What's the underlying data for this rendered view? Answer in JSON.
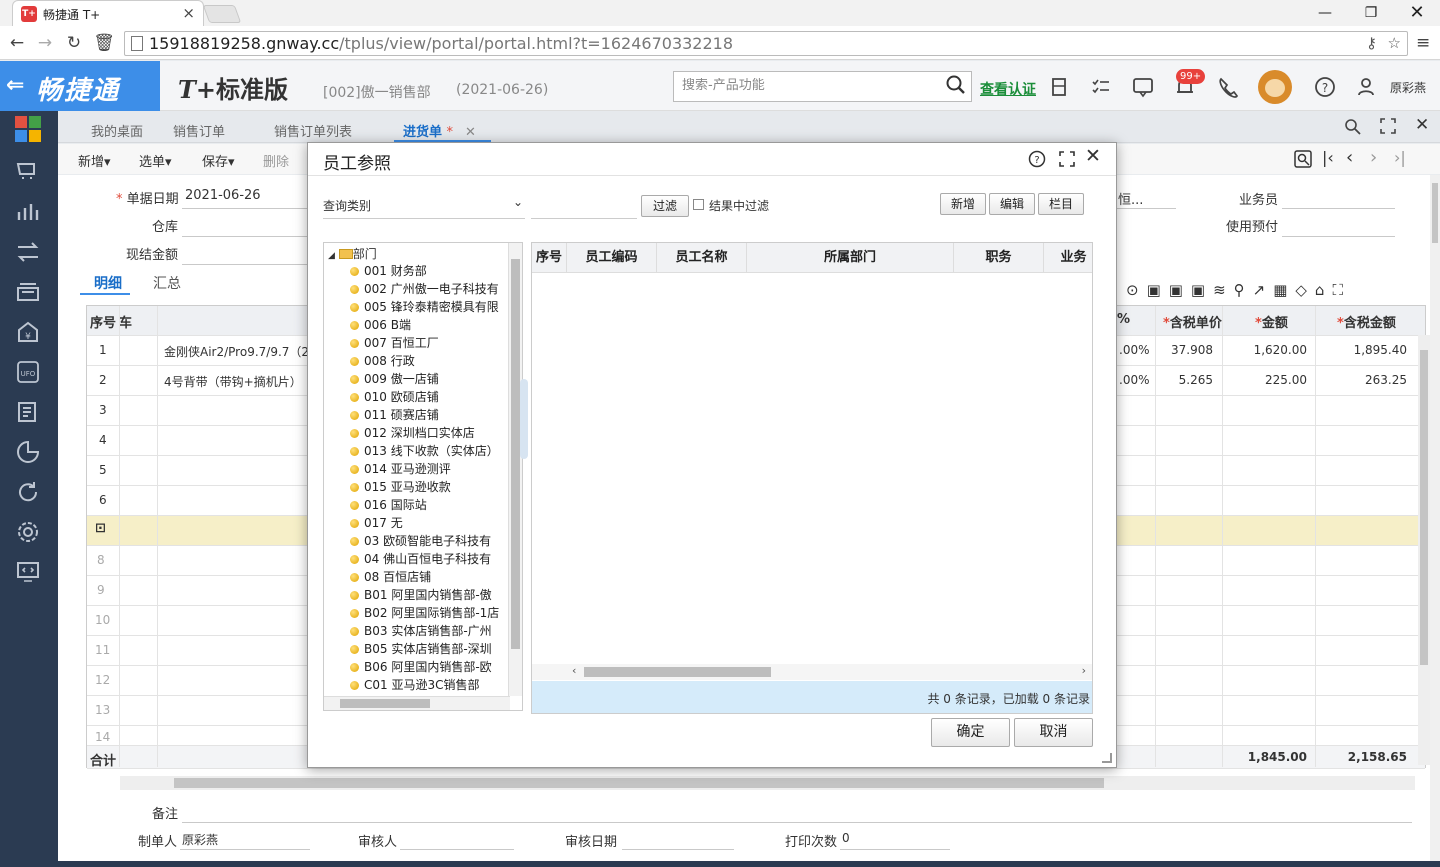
{
  "browser": {
    "tab_title": "畅捷通 T+",
    "favicon_text": "T+",
    "url_host": "15918819258.gnway.cc",
    "url_path": "/tplus/view/portal/portal.html?t=1624670332218"
  },
  "header": {
    "brand": "畅捷通",
    "edition_mark": "T+",
    "edition_name": "标准版",
    "department": "[002]傲一销售部",
    "date": "(2021-06-26)",
    "search_placeholder": "搜索-产品功能",
    "verify_link": "查看认证",
    "badge": "99+",
    "user": "原彩燕"
  },
  "tabs": [
    {
      "label": "我的桌面"
    },
    {
      "label": "销售订单"
    },
    {
      "label": "销售订单列表"
    },
    {
      "label": "进货单",
      "marker": "*"
    }
  ],
  "toolbar": {
    "new": "新增",
    "select": "选单",
    "save": "保存",
    "delete": "删除"
  },
  "form": {
    "date_label": "单据日期",
    "date_value": "2021-06-26",
    "warehouse_label": "仓库",
    "cash_label": "现结金额",
    "supplier_fragment": "恒...",
    "salesman_label": "业务员",
    "prepay_label": "使用预付",
    "subtab_detail": "明细",
    "subtab_summary": "汇总",
    "remark_label": "备注",
    "maker_label": "制单人",
    "maker_value": "原彩燕",
    "auditor_label": "审核人",
    "audit_date_label": "审核日期",
    "print_count_label": "打印次数",
    "print_count_value": "0"
  },
  "grid": {
    "col_seq": "序号",
    "col_fragment": "车",
    "col_pct": "%",
    "col_tax_price": "含税单价",
    "col_amount": "金额",
    "col_tax_amount": "含税金额",
    "rows": [
      {
        "seq": "1",
        "name": "金刚侠Air2/Pro9.7/9.7（2",
        "pct": ".00%",
        "tax_price": "37.908",
        "amount": "1,620.00",
        "tax_amount": "1,895.40"
      },
      {
        "seq": "2",
        "name": "4号背带（带钩+摘机片）",
        "pct": ".00%",
        "tax_price": "5.265",
        "amount": "225.00",
        "tax_amount": "263.25"
      }
    ],
    "empty_rows": [
      "3",
      "4",
      "5",
      "6",
      "8",
      "9",
      "10",
      "11",
      "12",
      "13",
      "14"
    ],
    "total_label": "合计",
    "total_amount": "1,845.00",
    "total_tax_amount": "2,158.65"
  },
  "dialog": {
    "title": "员工参照",
    "query_category": "查询类别",
    "filter_button": "过滤",
    "filter_in_result": "结果中过滤",
    "new_button": "新增",
    "edit_button": "编辑",
    "columns_button": "栏目",
    "tree_root": "部门",
    "tree_items": [
      "001 财务部",
      "002 广州傲一电子科技有",
      "005 锋玲泰精密模具有限",
      "006 B端",
      "007 百恒工厂",
      "008 行政",
      "009 傲一店铺",
      "010 欧硕店铺",
      "011 硕赛店铺",
      "012 深圳档口实体店",
      "013 线下收款（实体店）",
      "014 亚马逊测评",
      "015 亚马逊收款",
      "016 国际站",
      "017 无",
      "03 欧硕智能电子科技有",
      "04 佛山百恒电子科技有",
      "08 百恒店铺",
      "B01 阿里国内销售部-傲",
      "B02 阿里国际销售部-1店",
      "B03 实体店销售部-广州",
      "B05 实体店销售部-深圳",
      "B06 阿里国内销售部-欧",
      "C01 亚马逊3C销售部"
    ],
    "columns": [
      "序号",
      "员工编码",
      "员工名称",
      "所属部门",
      "职务",
      "业务"
    ],
    "status": "共 0 条记录，已加载 0 条记录",
    "ok_button": "确定",
    "cancel_button": "取消"
  }
}
